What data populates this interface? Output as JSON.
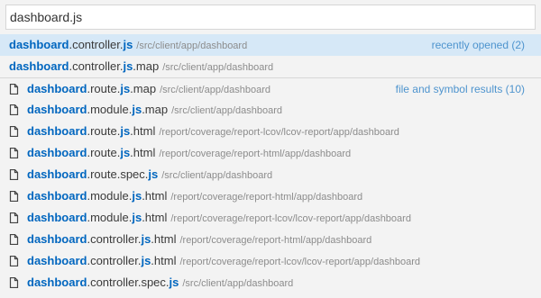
{
  "search": {
    "value": "dashboard.js"
  },
  "results": [
    {
      "hl": "dashboard",
      "mid": ".controller.",
      "hl2": "js",
      "tail": "",
      "path": "/src/client/app/dashboard",
      "label": "recently opened (2)",
      "icon": false,
      "selected": true
    },
    {
      "hl": "dashboard",
      "mid": ".controller.",
      "hl2": "js",
      "tail": ".map",
      "path": "/src/client/app/dashboard",
      "label": "",
      "icon": false,
      "selected": false
    },
    {
      "hl": "dashboard",
      "mid": ".route.",
      "hl2": "js",
      "tail": ".map",
      "path": "/src/client/app/dashboard",
      "label": "file and symbol results (10)",
      "icon": true,
      "selected": false
    },
    {
      "hl": "dashboard",
      "mid": ".module.",
      "hl2": "js",
      "tail": ".map",
      "path": "/src/client/app/dashboard",
      "label": "",
      "icon": true,
      "selected": false
    },
    {
      "hl": "dashboard",
      "mid": ".route.",
      "hl2": "js",
      "tail": ".html",
      "path": "/report/coverage/report-lcov/lcov-report/app/dashboard",
      "label": "",
      "icon": true,
      "selected": false
    },
    {
      "hl": "dashboard",
      "mid": ".route.",
      "hl2": "js",
      "tail": ".html",
      "path": "/report/coverage/report-html/app/dashboard",
      "label": "",
      "icon": true,
      "selected": false
    },
    {
      "hl": "dashboard",
      "mid": ".route.spec.",
      "hl2": "js",
      "tail": "",
      "path": "/src/client/app/dashboard",
      "label": "",
      "icon": true,
      "selected": false
    },
    {
      "hl": "dashboard",
      "mid": ".module.",
      "hl2": "js",
      "tail": ".html",
      "path": "/report/coverage/report-html/app/dashboard",
      "label": "",
      "icon": true,
      "selected": false
    },
    {
      "hl": "dashboard",
      "mid": ".module.",
      "hl2": "js",
      "tail": ".html",
      "path": "/report/coverage/report-lcov/lcov-report/app/dashboard",
      "label": "",
      "icon": true,
      "selected": false
    },
    {
      "hl": "dashboard",
      "mid": ".controller.",
      "hl2": "js",
      "tail": ".html",
      "path": "/report/coverage/report-html/app/dashboard",
      "label": "",
      "icon": true,
      "selected": false
    },
    {
      "hl": "dashboard",
      "mid": ".controller.",
      "hl2": "js",
      "tail": ".html",
      "path": "/report/coverage/report-lcov/lcov-report/app/dashboard",
      "label": "",
      "icon": true,
      "selected": false
    },
    {
      "hl": "dashboard",
      "mid": ".controller.spec.",
      "hl2": "js",
      "tail": "",
      "path": "/src/client/app/dashboard",
      "label": "",
      "icon": true,
      "selected": false
    }
  ],
  "colors": {
    "highlight": "#0066bf",
    "selected_bg": "#d6e8f7",
    "group_label": "#4e94ce"
  }
}
